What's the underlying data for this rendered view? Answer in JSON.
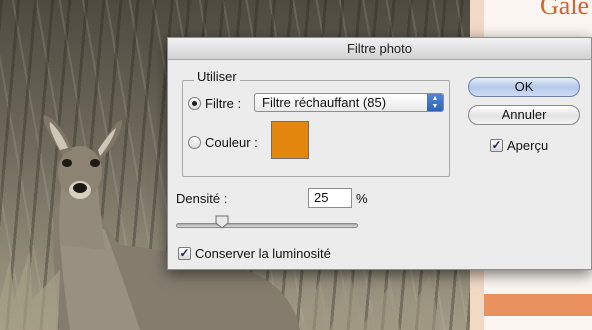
{
  "dialog": {
    "title": "Filtre photo",
    "use_group_label": "Utiliser",
    "filter_label": "Filtre :",
    "filter_value": "Filtre réchauffant (85)",
    "color_label": "Couleur :",
    "swatch_color": "#e3860d",
    "ok_label": "OK",
    "cancel_label": "Annuler",
    "preview_label": "Aperçu",
    "preview_checked": true,
    "density_label": "Densité :",
    "density_value": "25",
    "density_unit": "%",
    "density_fraction": 0.25,
    "preserve_label": "Conserver la luminosité",
    "preserve_checked": true
  },
  "webpage": {
    "title_partial": "Gale"
  }
}
